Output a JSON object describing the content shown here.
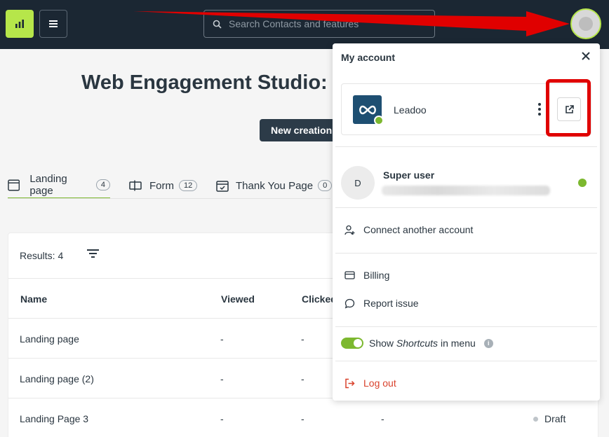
{
  "search": {
    "placeholder": "Search Contacts and features"
  },
  "page": {
    "title": "Web Engagement Studio: T",
    "new_button": "New creation"
  },
  "tabs": [
    {
      "label": "Landing page",
      "count": "4"
    },
    {
      "label": "Form",
      "count": "12"
    },
    {
      "label": "Thank You Page",
      "count": "0"
    }
  ],
  "table": {
    "results_label": "Results: 4",
    "headers": [
      "Name",
      "Viewed",
      "Clicked"
    ],
    "rows": [
      {
        "name": "Landing page",
        "viewed": "-",
        "clicked": "-"
      },
      {
        "name": "Landing page (2)",
        "viewed": "-",
        "clicked": "-"
      },
      {
        "name": "Landing Page 3",
        "viewed": "-",
        "clicked": "-",
        "extra": "-",
        "status": "Draft"
      }
    ]
  },
  "account_menu": {
    "title": "My account",
    "organization": "Leadoo",
    "user": {
      "initial": "D",
      "name": "Super user"
    },
    "connect_label": "Connect another account",
    "billing_label": "Billing",
    "report_label": "Report issue",
    "shortcuts": {
      "prefix": "Show",
      "emphasis": "Shortcuts",
      "suffix": "in menu",
      "enabled": true
    },
    "logout_label": "Log out"
  },
  "colors": {
    "topbar": "#1b2733",
    "accent": "#b6e64a",
    "success": "#7cb82f",
    "logout": "#d9412b",
    "annotation": "#e00000"
  }
}
